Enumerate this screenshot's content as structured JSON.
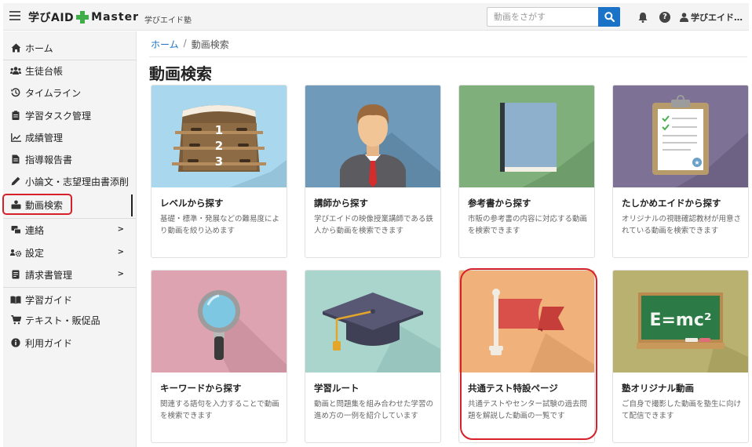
{
  "header": {
    "brand_left": "学びAID",
    "brand_right": "Master",
    "brand_sub": "学びエイド塾",
    "search_placeholder": "動画をさがす",
    "user_name": "学びエイド…"
  },
  "sidebar": {
    "items": [
      {
        "label": "ホーム",
        "icon": "home-icon"
      },
      {
        "label": "生徒台帳",
        "icon": "users-icon"
      },
      {
        "label": "タイムライン",
        "icon": "history-icon"
      },
      {
        "label": "学習タスク管理",
        "icon": "clipboard-icon"
      },
      {
        "label": "成績管理",
        "icon": "chart-icon"
      },
      {
        "label": "指導報告書",
        "icon": "file-icon"
      },
      {
        "label": "小論文・志望理由書添削",
        "icon": "pen-icon"
      },
      {
        "label": "動画検索",
        "icon": "video-search-icon"
      },
      {
        "label": "連絡",
        "icon": "message-icon"
      },
      {
        "label": "設定",
        "icon": "settings-icon"
      },
      {
        "label": "請求書管理",
        "icon": "invoice-icon"
      },
      {
        "label": "学習ガイド",
        "icon": "book-icon"
      },
      {
        "label": "テキスト・販促品",
        "icon": "cart-icon"
      },
      {
        "label": "利用ガイド",
        "icon": "info-icon"
      }
    ]
  },
  "breadcrumb": {
    "home": "ホーム",
    "separator": "/",
    "current": "動画検索"
  },
  "page_title": "動画検索",
  "cards": [
    {
      "title": "レベルから探す",
      "desc": "基礎・標準・発展などの難易度により動画を絞り込めます",
      "color": "#a9d8ee"
    },
    {
      "title": "講師から探す",
      "desc": "学びエイドの映像授業講師である鉄人から動画を検索できます",
      "color": "#6f9ab9"
    },
    {
      "title": "参考書から探す",
      "desc": "市販の参考書の内容に対応する動画を検索できます",
      "color": "#7fb07c"
    },
    {
      "title": "たしかめエイドから探す",
      "desc": "オリジナルの視聴確認教材が用意されている動画を検索できます",
      "color": "#7e7196"
    },
    {
      "title": "キーワードから探す",
      "desc": "関連する語句を入力することで動画を検索できます",
      "color": "#dea3b1"
    },
    {
      "title": "学習ルート",
      "desc": "動画と問題集を組み合わせた学習の進め方の一例を紹介しています",
      "color": "#a9d5cd"
    },
    {
      "title": "共通テスト特設ページ",
      "desc": "共通テストやセンター試験の過去問題を解説した動画の一覧です",
      "color": "#f0b27a"
    },
    {
      "title": "塾オリジナル動画",
      "desc": "ご自身で撮影した動画を塾生に向けて配信できます",
      "color": "#b9b16f"
    }
  ],
  "chalkboard_text": "E=mc²",
  "level_numbers": [
    "1",
    "2",
    "3"
  ]
}
